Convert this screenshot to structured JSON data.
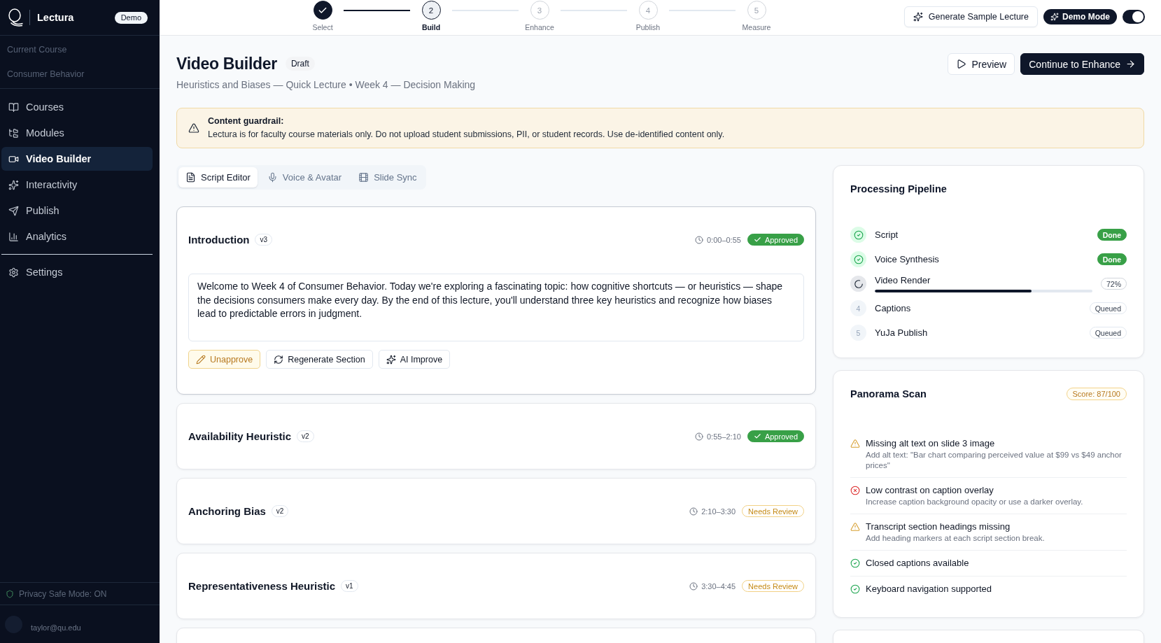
{
  "sidebar": {
    "brand": "Lectura",
    "badge": "Demo",
    "course_label": "Current Course",
    "course_name": "Consumer Behavior",
    "nav": [
      {
        "label": "Courses",
        "selected": false
      },
      {
        "label": "Modules",
        "selected": false
      },
      {
        "label": "Video Builder",
        "selected": true
      },
      {
        "label": "Interactivity",
        "selected": false
      },
      {
        "label": "Publish",
        "selected": false
      },
      {
        "label": "Analytics",
        "selected": false
      }
    ],
    "settings": {
      "label": "Settings",
      "selected": false
    },
    "privacy": "Privacy Safe Mode: ON",
    "user": {
      "email": "taylor@qu.edu"
    }
  },
  "stepper": [
    {
      "label": "Select",
      "completed": true,
      "selected": false
    },
    {
      "number": "2",
      "label": "Build",
      "completed": false,
      "selected": true
    },
    {
      "number": "3",
      "label": "Enhance",
      "completed": false,
      "selected": false
    },
    {
      "number": "4",
      "label": "Publish",
      "completed": false,
      "selected": false
    },
    {
      "number": "5",
      "label": "Measure",
      "completed": false,
      "selected": false
    }
  ],
  "header_actions": {
    "generate": "Generate Sample Lecture",
    "demo_mode": {
      "label": "Demo Mode",
      "on": true
    }
  },
  "page": {
    "title": "Video Builder",
    "badge": "Draft",
    "subtitle": "Heuristics and Biases — Quick Lecture • Week 4 — Decision Making",
    "buttons": [
      {
        "label": "Preview",
        "kind": "secondary"
      },
      {
        "label": "Continue to Enhance",
        "kind": "primary"
      }
    ]
  },
  "guardrail": {
    "title": "Content guardrail:",
    "text": "Lectura is for faculty course materials only. Do not upload student submissions, PII, or student records. Use de-identified content only."
  },
  "tabs": [
    {
      "label": "Script Editor",
      "selected": true
    },
    {
      "label": "Voice & Avatar",
      "selected": false
    },
    {
      "label": "Slide Sync",
      "selected": false
    }
  ],
  "sections": [
    {
      "title": "Introduction",
      "version": "v3",
      "time": "0:00–0:55",
      "status": "Approved",
      "approved": true,
      "expanded": true,
      "script": "Welcome to Week 4 of Consumer Behavior. Today we're exploring a fascinating topic: how cognitive shortcuts — or heuristics — shape the decisions consumers make every day. By the end of this lecture, you'll understand three key heuristics and recognize how biases lead to predictable errors in judgment.",
      "actions": [
        {
          "label": "Unapprove",
          "kind": "warning"
        },
        {
          "label": "Regenerate Section",
          "kind": "default"
        },
        {
          "label": "AI Improve",
          "kind": "default"
        }
      ]
    },
    {
      "title": "Availability Heuristic",
      "version": "v2",
      "time": "0:55–2:10",
      "status": "Approved",
      "approved": true,
      "expanded": false
    },
    {
      "title": "Anchoring Bias",
      "version": "v2",
      "time": "2:10–3:30",
      "status": "Needs Review",
      "approved": false,
      "expanded": false
    },
    {
      "title": "Representativeness Heuristic",
      "version": "v1",
      "time": "3:30–4:45",
      "status": "Needs Review",
      "approved": false,
      "expanded": false
    }
  ],
  "pipeline": {
    "title": "Processing Pipeline",
    "steps": [
      {
        "kind": "done",
        "label": "Script",
        "badge": "Done"
      },
      {
        "kind": "done",
        "label": "Voice Synthesis",
        "badge": "Done"
      },
      {
        "kind": "running",
        "label": "Video Render",
        "badge": "72%",
        "level": 0.72
      },
      {
        "kind": "queued",
        "number": "4",
        "label": "Captions",
        "badge": "Queued"
      },
      {
        "kind": "queued",
        "number": "5",
        "label": "YuJa Publish",
        "badge": "Queued"
      }
    ]
  },
  "panorama": {
    "title": "Panorama Scan",
    "score": "Score: 87/100",
    "checks": [
      {
        "kind": "warning",
        "title": "Missing alt text on slide 3 image",
        "detail": "Add alt text: \"Bar chart comparing perceived value at $99 vs $49 anchor prices\""
      },
      {
        "kind": "error",
        "title": "Low contrast on caption overlay",
        "detail": "Increase caption background opacity or use a darker overlay."
      },
      {
        "kind": "warning",
        "title": "Transcript section headings missing",
        "detail": "Add heading markers at each script section break."
      },
      {
        "kind": "pass",
        "title": "Closed captions available"
      },
      {
        "kind": "pass",
        "title": "Keyboard navigation supported"
      }
    ]
  }
}
